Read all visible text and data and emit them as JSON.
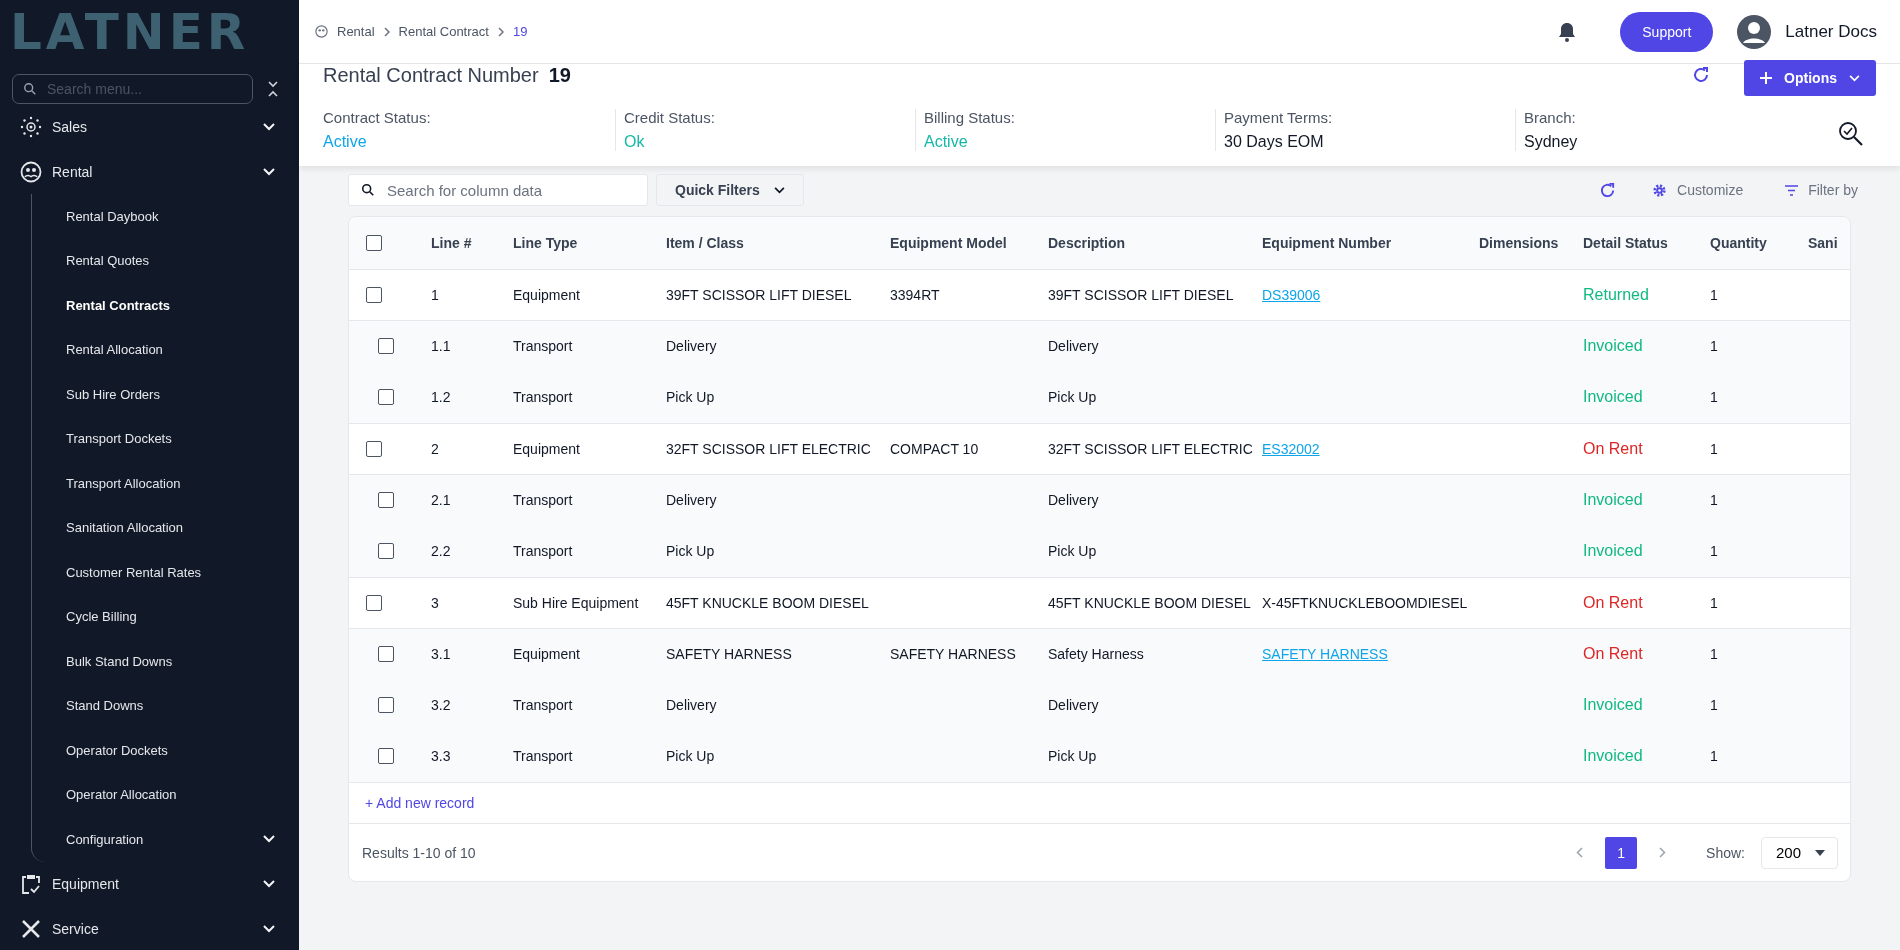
{
  "sidebar": {
    "logo": "LATNER",
    "search": {
      "placeholder": "Search menu..."
    },
    "items": [
      {
        "label": "Sales"
      },
      {
        "label": "Rental",
        "children": [
          {
            "label": "Rental Daybook",
            "selected": false
          },
          {
            "label": "Rental Quotes",
            "selected": false
          },
          {
            "label": "Rental Contracts",
            "selected": true
          },
          {
            "label": "Rental Allocation",
            "selected": false
          },
          {
            "label": "Sub Hire Orders",
            "selected": false
          },
          {
            "label": "Transport Dockets",
            "selected": false
          },
          {
            "label": "Transport Allocation",
            "selected": false
          },
          {
            "label": "Sanitation Allocation",
            "selected": false
          },
          {
            "label": "Customer Rental Rates",
            "selected": false
          },
          {
            "label": "Cycle Billing",
            "selected": false
          },
          {
            "label": "Bulk Stand Downs",
            "selected": false
          },
          {
            "label": "Stand Downs",
            "selected": false
          },
          {
            "label": "Operator Dockets",
            "selected": false
          },
          {
            "label": "Operator Allocation",
            "selected": false
          },
          {
            "label": "Configuration",
            "selected": false,
            "expandable": true
          }
        ]
      },
      {
        "label": "Equipment"
      },
      {
        "label": "Service"
      }
    ]
  },
  "breadcrumb": [
    "Rental",
    "Rental Contract",
    "19"
  ],
  "topbar": {
    "support": "Support",
    "user": "Latner Docs"
  },
  "header": {
    "title": "Rental Contract Number",
    "number": "19",
    "options": "Options",
    "fields": [
      {
        "label": "Contract Status:",
        "value": "Active",
        "color": "#0ea5e9"
      },
      {
        "label": "Credit Status:",
        "value": "Ok",
        "color": "#14b8a6"
      },
      {
        "label": "Billing Status:",
        "value": "Active",
        "color": "#14b8a6"
      },
      {
        "label": "Payment Terms:",
        "value": "30 Days EOM",
        "color": "#111827"
      },
      {
        "label": "Branch:",
        "value": "Sydney",
        "color": "#111827"
      }
    ]
  },
  "toolbar": {
    "search": {
      "placeholder": "Search for column data"
    },
    "quick_filters": "Quick Filters",
    "customize": "Customize",
    "filter_by": "Filter by"
  },
  "table": {
    "all_checked": false,
    "columns": [
      "Line #",
      "Line Type",
      "Item / Class",
      "Equipment Model",
      "Description",
      "Equipment Number",
      "Dimensions",
      "Detail Status",
      "Quantity",
      "Sani"
    ],
    "rows": [
      {
        "kind": "line",
        "checked": false,
        "cells": [
          "1",
          "Equipment",
          "39FT SCISSOR LIFT DIESEL",
          "3394RT",
          "39FT SCISSOR LIFT DIESEL",
          "DS39006",
          "",
          "Returned",
          "1",
          ""
        ],
        "linked": true,
        "color": "#10b981"
      },
      {
        "kind": "sub",
        "checked": false,
        "cells": [
          "1.1",
          "Transport",
          "Delivery",
          "",
          "Delivery",
          "",
          "",
          "Invoiced",
          "1",
          ""
        ],
        "color": "#10b981"
      },
      {
        "kind": "sub",
        "checked": false,
        "cells": [
          "1.2",
          "Transport",
          "Pick Up",
          "",
          "Pick Up",
          "",
          "",
          "Invoiced",
          "1",
          ""
        ],
        "color": "#10b981"
      },
      {
        "kind": "line",
        "checked": false,
        "cells": [
          "2",
          "Equipment",
          "32FT SCISSOR LIFT ELECTRIC",
          "COMPACT 10",
          "32FT SCISSOR LIFT ELECTRIC",
          "ES32002",
          "",
          "On Rent",
          "1",
          ""
        ],
        "linked": true,
        "color": "#dc2626"
      },
      {
        "kind": "sub",
        "checked": false,
        "cells": [
          "2.1",
          "Transport",
          "Delivery",
          "",
          "Delivery",
          "",
          "",
          "Invoiced",
          "1",
          ""
        ],
        "color": "#10b981"
      },
      {
        "kind": "sub",
        "checked": false,
        "cells": [
          "2.2",
          "Transport",
          "Pick Up",
          "",
          "Pick Up",
          "",
          "",
          "Invoiced",
          "1",
          ""
        ],
        "color": "#10b981"
      },
      {
        "kind": "line",
        "checked": false,
        "cells": [
          "3",
          "Sub Hire Equipment",
          "45FT KNUCKLE BOOM DIESEL",
          "",
          "45FT KNUCKLE BOOM DIESEL",
          "X-45FTKNUCKLEBOOMDIESEL",
          "",
          "On Rent",
          "1",
          ""
        ],
        "linked": false,
        "color": "#dc2626"
      },
      {
        "kind": "sub",
        "checked": false,
        "cells": [
          "3.1",
          "Equipment",
          "SAFETY HARNESS",
          "SAFETY HARNESS",
          "Safety Harness",
          "SAFETY HARNESS",
          "",
          "On Rent",
          "1",
          ""
        ],
        "linked": true,
        "color": "#dc2626"
      },
      {
        "kind": "sub",
        "checked": false,
        "cells": [
          "3.2",
          "Transport",
          "Delivery",
          "",
          "Delivery",
          "",
          "",
          "Invoiced",
          "1",
          ""
        ],
        "color": "#10b981"
      },
      {
        "kind": "sub",
        "checked": false,
        "cells": [
          "3.3",
          "Transport",
          "Pick Up",
          "",
          "Pick Up",
          "",
          "",
          "Invoiced",
          "1",
          ""
        ],
        "color": "#10b981"
      }
    ],
    "add_record": "+ Add new record"
  },
  "footer": {
    "results": "Results 1-10 of 10",
    "pages": [
      {
        "label": "1",
        "selected": true
      }
    ],
    "show_label": "Show:",
    "show_value": "200"
  }
}
